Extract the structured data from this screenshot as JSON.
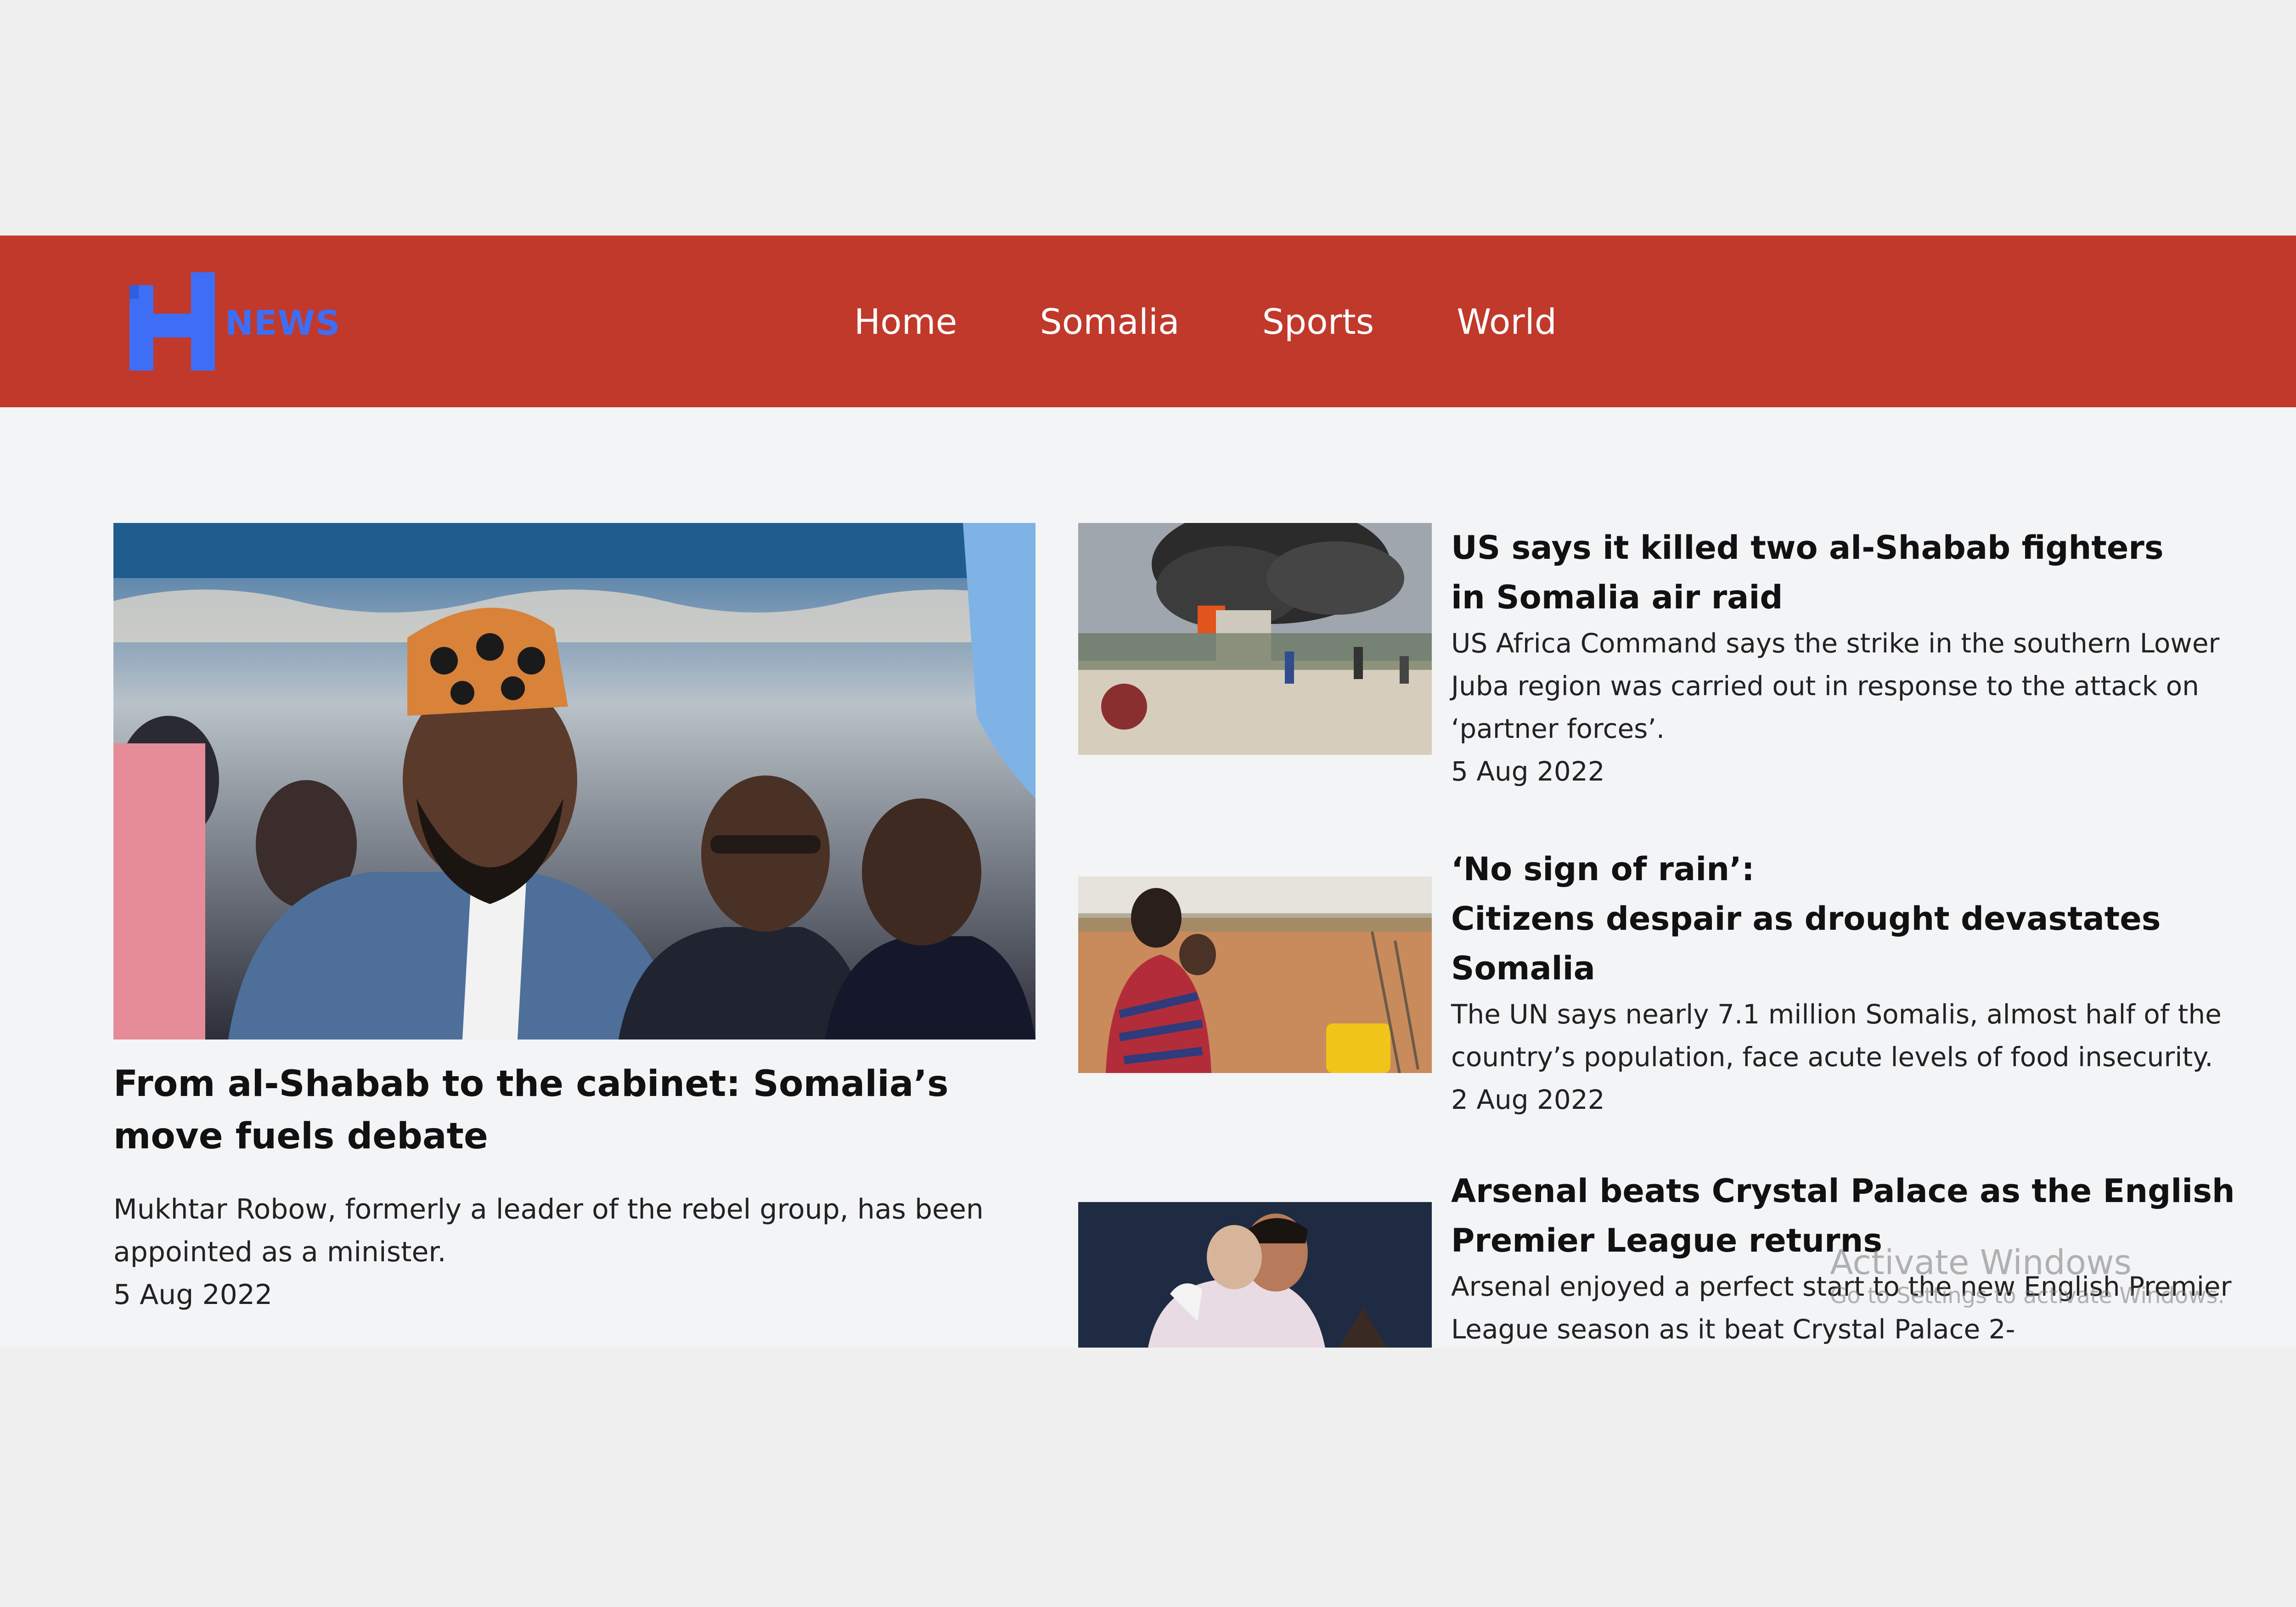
{
  "brand": {
    "logo_letter": "H",
    "logo_text": "NEWS",
    "logo_color": "#3d6ef5",
    "nav_bg": "#c0392b"
  },
  "nav": {
    "items": [
      "Home",
      "Somalia",
      "Sports",
      "World"
    ]
  },
  "main_story": {
    "title": "From al-Shabab to the cabinet: Somalia’s move fuels debate",
    "description": "Mukhtar Robow, formerly a leader of the rebel group, has been appointed as a minister.",
    "date": "5 Aug 2022",
    "image": "man-in-kufi-cap-at-ceremony"
  },
  "side_stories": [
    {
      "title_line1": "US says it killed two al-Shabab fighters",
      "title_line2": "in Somalia air raid",
      "description": "US Africa Command says the strike in the southern Lower Juba region was carried out in response to the attack on ‘partner forces’.",
      "date": "5 Aug 2022",
      "image": "explosion-smoke-street-scene"
    },
    {
      "title_line1": "‘No sign of rain’:",
      "title_line2": "Citizens despair as drought devastates Somalia",
      "description": "The UN says nearly 7.1 million Somalis, almost half of the country’s population, face acute levels of food insecurity.",
      "date": "2 Aug 2022",
      "image": "woman-with-child-in-drought-camp"
    },
    {
      "title_line1": "Arsenal beats Crystal Palace as the English",
      "title_line2": "Premier League returns",
      "description": "Arsenal enjoyed a perfect start to the new English Premier League season as it beat Crystal Palace 2-",
      "date": "",
      "image": "footballers-embracing"
    }
  ],
  "watermark": {
    "line1": "Activate Windows",
    "line2": "Go to Settings to activate Windows."
  }
}
